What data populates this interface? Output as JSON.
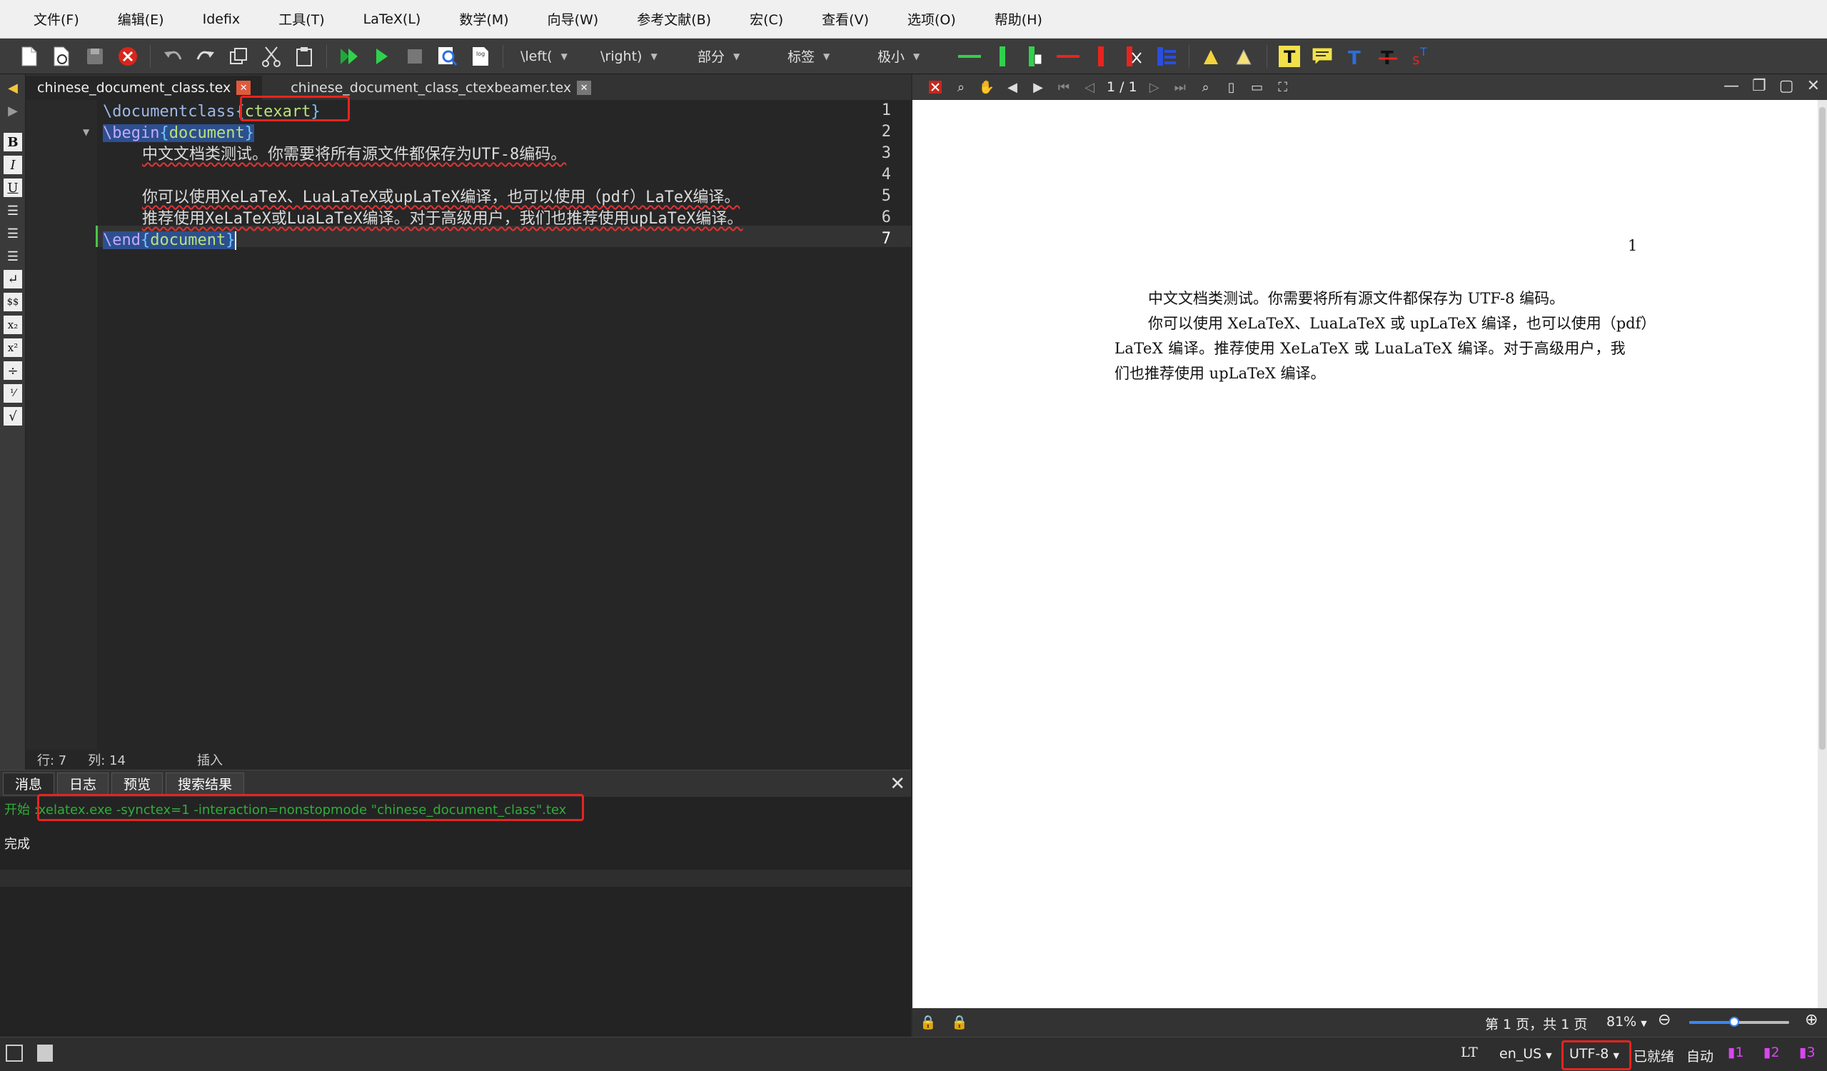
{
  "menubar": {
    "items": [
      "文件(F)",
      "编辑(E)",
      "Idefix",
      "工具(T)",
      "LaTeX(L)",
      "数学(M)",
      "向导(W)",
      "参考文献(B)",
      "宏(C)",
      "查看(V)",
      "选项(O)",
      "帮助(H)"
    ]
  },
  "toolbar": {
    "left_combo": "\\left(",
    "right_combo": "\\right)",
    "section_combo": "部分",
    "label_combo": "标签",
    "size_combo": "极小"
  },
  "tabs": [
    {
      "label": "chinese_document_class.tex",
      "active": true
    },
    {
      "label": "chinese_document_class_ctexbeamer.tex",
      "active": false
    }
  ],
  "editor": {
    "line_numbers": [
      "1",
      "2",
      "3",
      "4",
      "5",
      "6",
      "7"
    ],
    "line1": {
      "cmd": "\\documentclass",
      "open": "{",
      "arg": "ctexart",
      "close": "}"
    },
    "line2": {
      "cmd": "\\begin",
      "open": "{",
      "arg": "document",
      "close": "}"
    },
    "line3": "中文文档类测试。你需要将所有源文件都保存为UTF-8编码。",
    "line5": "你可以使用XeLaTeX、LuaLaTeX或upLaTeX编译，也可以使用（pdf）LaTeX编译。",
    "line6": "推荐使用XeLaTeX或LuaLaTeX编译。对于高级用户，我们也推荐使用upLaTeX编译。",
    "line7": {
      "cmd": "\\end",
      "open": "{",
      "arg": "document",
      "close": "}"
    },
    "status": {
      "row_label": "行: 7",
      "col_label": "列: 14",
      "mode": "插入"
    }
  },
  "messages": {
    "tabs": [
      "消息",
      "日志",
      "预览",
      "搜索结果"
    ],
    "start_prefix": "开始 :",
    "command": "xelatex.exe -synctex=1 -interaction=nonstopmode \"chinese_document_class\".tex",
    "done": "完成"
  },
  "pdf": {
    "page_indicator": "1 / 1",
    "page_number": "1",
    "para1": "中文文档类测试。你需要将所有源文件都保存为 UTF-8 编码。",
    "para2_l1": "你可以使用 XeLaTeX、LuaLaTeX 或 upLaTeX 编译，也可以使用（pdf）",
    "para2_l2": "LaTeX 编译。推荐使用 XeLaTeX 或 LuaLaTeX 编译。对于高级用户，我",
    "para2_l3": "们也推荐使用 upLaTeX 编译。",
    "status_page": "第 1 页，共 1 页",
    "zoom": "81%",
    "zoom_fraction": 0.45
  },
  "statusbar": {
    "language": "en_US",
    "encoding": "UTF-8",
    "ready": "已就绪",
    "auto": "自动",
    "lt_label": "LT",
    "bookmarks": [
      "1",
      "2",
      "3"
    ]
  },
  "colors": {
    "accent_red": "#e8241e",
    "link_blue": "#3a86ff"
  }
}
